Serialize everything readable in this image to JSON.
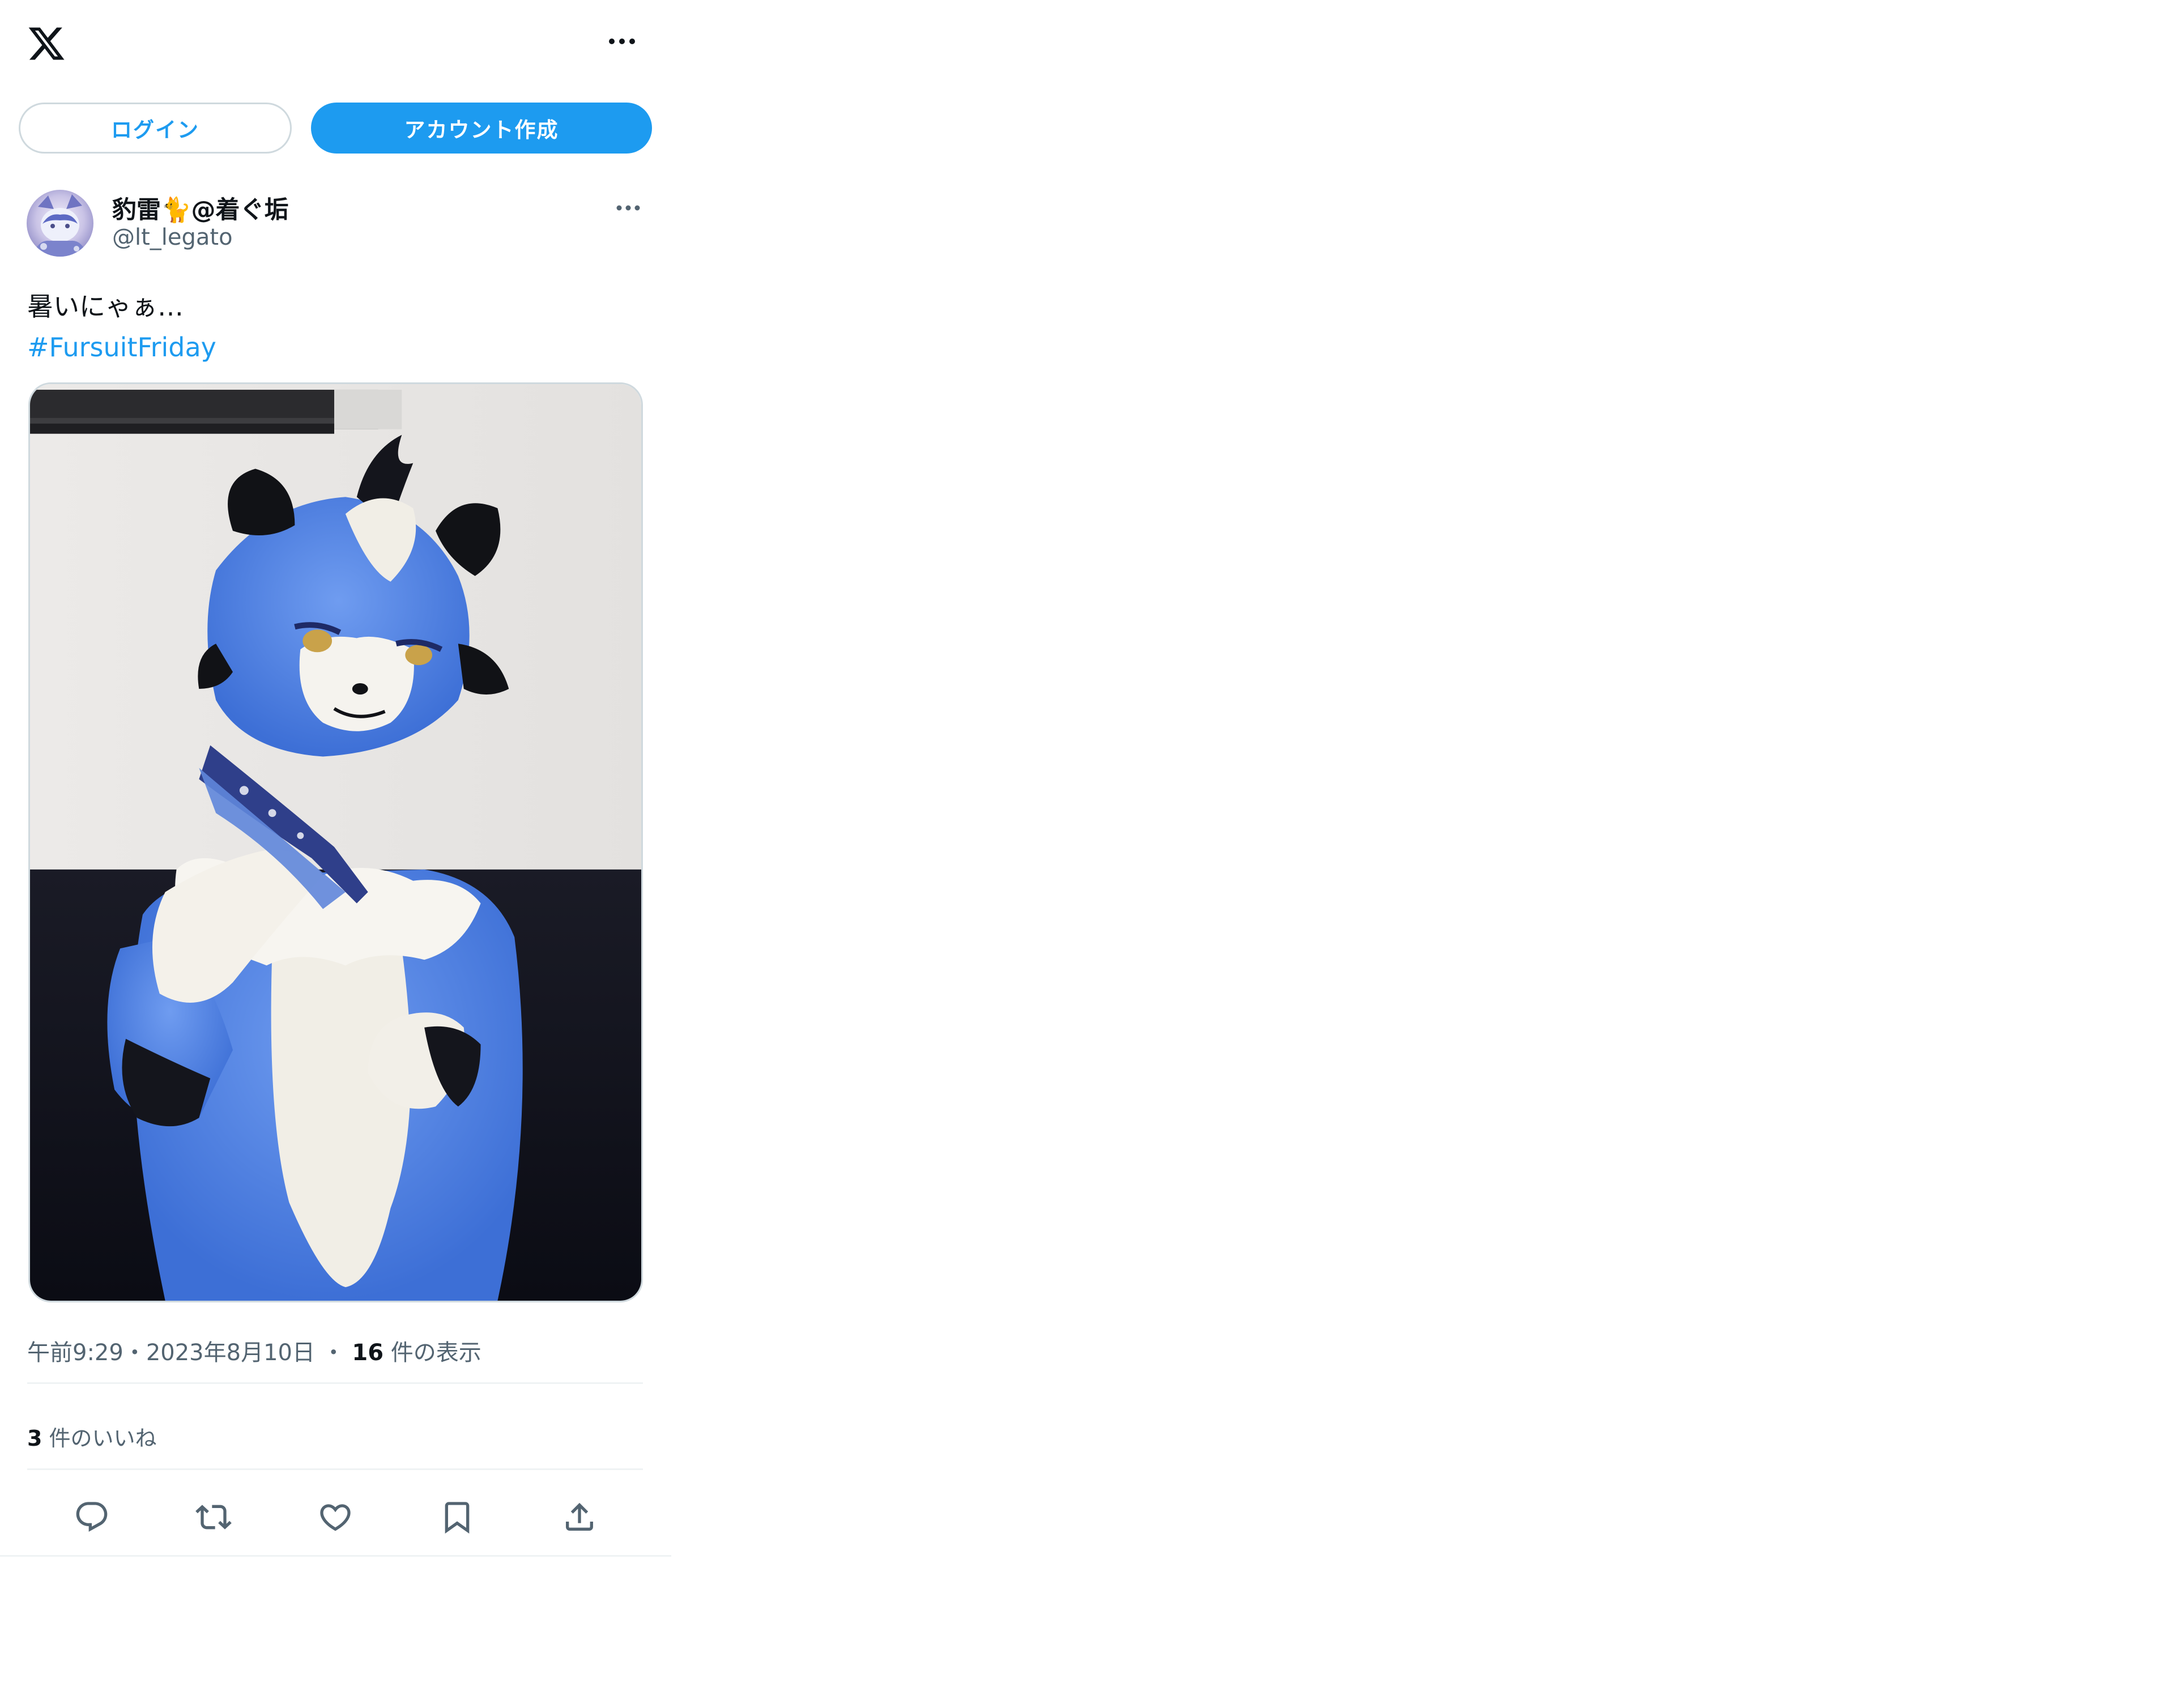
{
  "header": {
    "logo_icon": "x-logo-icon",
    "more_icon": "more-horizontal-icon"
  },
  "auth": {
    "login_label": "ログイン",
    "signup_label": "アカウント作成",
    "accent_color": "#1d9bf0"
  },
  "tweet": {
    "author": {
      "display_name": "豹雷🐈@着ぐ垢",
      "handle": "@lt_legato"
    },
    "text_line1": "暑いにゃぁ…",
    "hashtag": "#FursuitFriday",
    "time": "午前9:29",
    "separator1": "・",
    "date": "2023年8月10日",
    "separator2": "・",
    "views_count": "16",
    "views_label": " 件の表示",
    "likes_count": "3",
    "likes_label": " 件のいいね"
  },
  "actions": [
    {
      "icon": "reply-icon"
    },
    {
      "icon": "retweet-icon"
    },
    {
      "icon": "like-icon"
    },
    {
      "icon": "bookmark-icon"
    },
    {
      "icon": "share-icon"
    }
  ]
}
